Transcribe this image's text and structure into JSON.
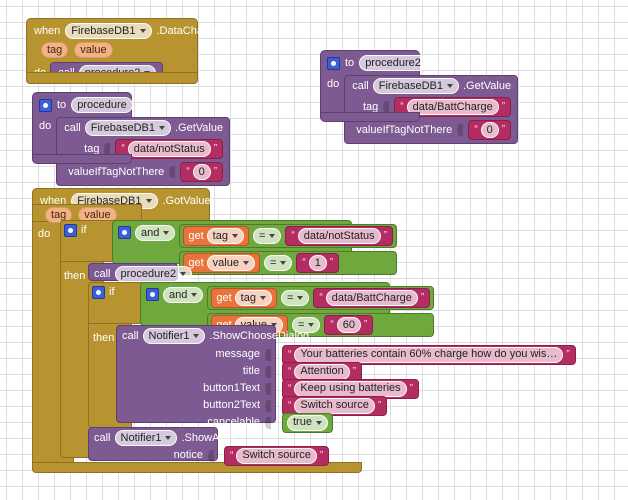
{
  "app": {
    "editor": "MIT App Inventor Blocks Editor",
    "canvas_background": "#ffffff",
    "grid_dot_color": "#dcdce2"
  },
  "palette": {
    "event_color": "#b89430",
    "control_color": "#b89430",
    "procedure_color": "#7d5a92",
    "logic_color": "#6fa83d",
    "text_color": "#b32d62",
    "math_color": "#b32d62",
    "variable_get_color": "#e8743b",
    "mutator_color": "#3b5fd6"
  },
  "blocks": {
    "event_datachanged": {
      "when_label": "when",
      "component": "FirebaseDB1",
      "event": ".DataChanged",
      "params": [
        "tag",
        "value"
      ],
      "do_label": "do",
      "body": {
        "call_label": "call",
        "procedure": "procedure2"
      }
    },
    "proc_procedure2": {
      "to_label": "to",
      "name": "procedure2",
      "do_label": "do",
      "body": {
        "call_label": "call",
        "component": "FirebaseDB1",
        "method": ".GetValue",
        "args": [
          {
            "label": "tag",
            "value": "data/BattCharge",
            "type": "text"
          },
          {
            "label": "valueIfTagNotThere",
            "value": "0",
            "type": "math"
          }
        ]
      }
    },
    "proc_procedure": {
      "to_label": "to",
      "name": "procedure",
      "do_label": "do",
      "body": {
        "call_label": "call",
        "component": "FirebaseDB1",
        "method": ".GetValue",
        "args": [
          {
            "label": "tag",
            "value": "data/notStatus",
            "type": "text"
          },
          {
            "label": "valueIfTagNotThere",
            "value": "0",
            "type": "math"
          }
        ]
      }
    },
    "event_gotvalue": {
      "when_label": "when",
      "component": "FirebaseDB1",
      "event": ".GotValue",
      "params": [
        "tag",
        "value"
      ],
      "do_label": "do",
      "outer_if": {
        "if_label": "if",
        "then_label": "then",
        "condition": {
          "operator": "and",
          "comparisons": [
            {
              "get_label": "get",
              "variable": "tag",
              "operator": "=",
              "value": "data/notStatus",
              "value_type": "text"
            },
            {
              "get_label": "get",
              "variable": "value",
              "operator": "=",
              "value": "1",
              "value_type": "math"
            }
          ]
        },
        "then_body": {
          "call_procedure": {
            "call_label": "call",
            "procedure": "procedure2"
          },
          "inner_if": {
            "if_label": "if",
            "then_label": "then",
            "condition": {
              "operator": "and",
              "comparisons": [
                {
                  "get_label": "get",
                  "variable": "tag",
                  "operator": "=",
                  "value": "data/BattCharge",
                  "value_type": "text"
                },
                {
                  "get_label": "get",
                  "variable": "value",
                  "operator": "=",
                  "value": "60",
                  "value_type": "math"
                }
              ]
            },
            "then_body": {
              "call_label": "call",
              "component": "Notifier1",
              "method": ".ShowChooseDialog",
              "args": [
                {
                  "label": "message",
                  "value": "Your batteries contain 60% charge how do you wis…",
                  "type": "text"
                },
                {
                  "label": "title",
                  "value": "Attention",
                  "type": "text"
                },
                {
                  "label": "button1Text",
                  "value": "Keep using batteries",
                  "type": "text"
                },
                {
                  "label": "button2Text",
                  "value": "Switch source",
                  "type": "text"
                },
                {
                  "label": "cancelable",
                  "value": "true",
                  "type": "logic"
                }
              ]
            }
          }
        },
        "else_body": {
          "call_label": "call",
          "component": "Notifier1",
          "method": ".ShowAlert",
          "args": [
            {
              "label": "notice",
              "value": "Switch source",
              "type": "text"
            }
          ]
        }
      }
    }
  }
}
